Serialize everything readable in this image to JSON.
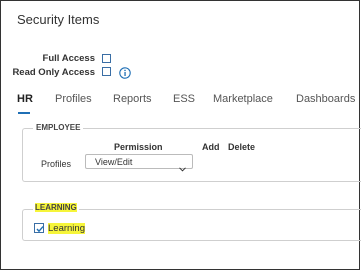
{
  "page": {
    "title": "Security Items"
  },
  "access": {
    "full_access_label": "Full Access",
    "read_only_label": "Read Only Access",
    "full_access_checked": false,
    "read_only_checked": false
  },
  "tabs": [
    {
      "label": "HR",
      "active": true
    },
    {
      "label": "Profiles",
      "active": false
    },
    {
      "label": "Reports",
      "active": false
    },
    {
      "label": "ESS",
      "active": false
    },
    {
      "label": "Marketplace",
      "active": false
    },
    {
      "label": "Dashboards",
      "active": false
    }
  ],
  "employee": {
    "legend": "EMPLOYEE",
    "columns": {
      "permission": "Permission",
      "add": "Add",
      "delete": "Delete"
    },
    "rows": [
      {
        "label": "Profiles",
        "permission_value": "View/Edit"
      }
    ]
  },
  "learning": {
    "legend": "LEARNING",
    "checkbox_label": "Learning",
    "checked": true
  },
  "colors": {
    "accent": "#1f6fb5",
    "highlight": "#f6f53a",
    "checkbox_border": "#3a6ea5"
  }
}
